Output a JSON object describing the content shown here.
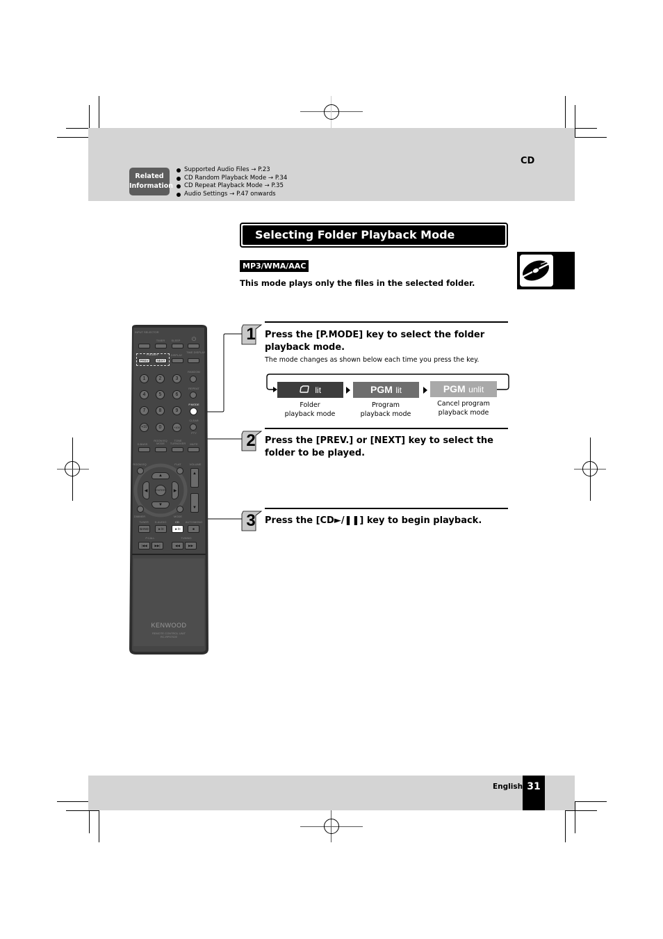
{
  "header": {
    "section": "CD",
    "related": {
      "badge_line1": "Related",
      "badge_line2": "Information",
      "items": [
        "Supported Audio Files → P.23",
        "CD Random Playback Mode → P.34",
        "CD Repeat Playback Mode → P.35",
        "Audio Settings → P.47 onwards"
      ]
    }
  },
  "main": {
    "title": "Selecting Folder Playback Mode",
    "format_tag": "MP3/WMA/AAC",
    "intro": "This mode plays only the files in the selected folder.",
    "cd_tab_icon": "cd-disc-icon",
    "steps": [
      {
        "number": "1",
        "title": "Press the [P.MODE] key to select the folder playback mode.",
        "note": "The mode changes as shown below each time you press the key.",
        "modes": [
          {
            "indicator_icon": "folder-icon",
            "indicator_big": "",
            "indicator_small": "lit",
            "caption_line1": "Folder",
            "caption_line2": "playback mode",
            "color": "#3d3d3d"
          },
          {
            "indicator_icon": "",
            "indicator_big": "PGM",
            "indicator_small": "lit",
            "caption_line1": "Program",
            "caption_line2": "playback mode",
            "color": "#6e6e6e"
          },
          {
            "indicator_icon": "",
            "indicator_big": "PGM",
            "indicator_small": "unlit",
            "caption_line1": "Cancel program",
            "caption_line2": "playback mode",
            "color": "#a9a9a9"
          }
        ]
      },
      {
        "number": "2",
        "title": "Press the [PREV.] or [NEXT] key to select the folder to be played."
      },
      {
        "number": "3",
        "title": "Press the [CD►/❚❚] key to begin playback."
      }
    ]
  },
  "remote": {
    "brand": "KENWOOD",
    "model_line1": "REMOTE CONTROL UNIT",
    "model_line2": "RC-RP0702E",
    "labels": {
      "input_selector": "INPUT SELECTOR",
      "timer": "TIMER",
      "sleep": "SLEEP",
      "power": "⏻",
      "folder": "FOLDER",
      "prev": "PREV",
      "next": "NEXT",
      "display": "DISPLAY",
      "time_display": "TIME DISPLAY",
      "random": "RANDOM",
      "repeat": "REPEAT",
      "p_mode": "P.MODE",
      "clear": "CLEAR",
      "pty": "PTY",
      "d_bass": "D.BASS",
      "room_eq_mode": "ROOM EQ MODE",
      "tone_turnover": "TONE TURNOVER",
      "mute": "MUTE",
      "room_eq": "ROOM EQ",
      "flat": "FLAT",
      "volume": "VOLUME",
      "enter": "ENTER",
      "dimmer": "DIMMER",
      "mode": "MODE",
      "tuner": "TUNER",
      "d_audio": "D.AUDIO",
      "cd": "CD",
      "auto_mono": "AUTO/MONO",
      "band": "BAND",
      "play_pause": "►/II",
      "stop": "■",
      "p_call": "P.CALL",
      "tuning": "TUNING"
    },
    "number_keys": [
      "1",
      "2",
      "3",
      "4",
      "5",
      "6",
      "7",
      "8",
      "9",
      "+10",
      "0",
      "+100"
    ]
  },
  "footer": {
    "language": "English",
    "page_number": "31"
  }
}
